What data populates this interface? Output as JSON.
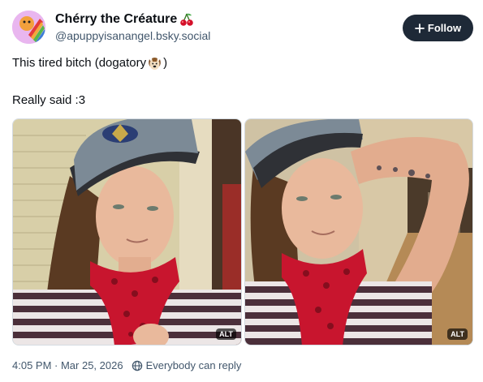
{
  "author": {
    "display_name": "Chérry the Créature",
    "name_emoji": "cherries-emoji",
    "handle": "@apuppyisanangel.bsky.social"
  },
  "follow_button": {
    "label": "Follow",
    "icon": "plus-icon"
  },
  "post": {
    "line1_text": "This tired bitch (dogatory",
    "line1_emoji": "dog-face-emoji",
    "line1_close": ")",
    "line2_text": "Really said :3"
  },
  "images": [
    {
      "alt_label": "ALT"
    },
    {
      "alt_label": "ALT"
    }
  ],
  "footer": {
    "timestamp": "4:05 PM · Mar 25, 2026",
    "reply_setting": "Everybody can reply",
    "reply_icon": "globe-icon"
  },
  "colors": {
    "follow_bg": "#1e2937",
    "muted_text": "#42576c",
    "scarf_red": "#c8152e"
  }
}
